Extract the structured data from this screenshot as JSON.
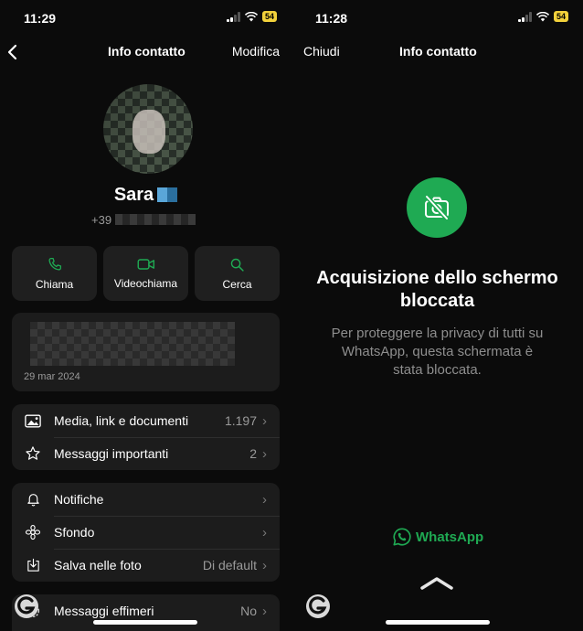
{
  "left": {
    "status": {
      "time": "11:29",
      "battery": "54"
    },
    "nav": {
      "title": "Info contatto",
      "edit": "Modifica"
    },
    "profile": {
      "name": "Sara",
      "phone_prefix": "+39"
    },
    "actions": [
      {
        "icon": "phone-icon",
        "label": "Chiama"
      },
      {
        "icon": "video-icon",
        "label": "Videochiama"
      },
      {
        "icon": "search-icon",
        "label": "Cerca"
      }
    ],
    "about": {
      "date": "29 mar 2024"
    },
    "group1": [
      {
        "icon": "photo-icon",
        "label": "Media, link e documenti",
        "value": "1.197"
      },
      {
        "icon": "star-icon",
        "label": "Messaggi importanti",
        "value": "2"
      }
    ],
    "group2": [
      {
        "icon": "bell-icon",
        "label": "Notifiche",
        "value": ""
      },
      {
        "icon": "wallpaper-icon",
        "label": "Sfondo",
        "value": ""
      },
      {
        "icon": "download-icon",
        "label": "Salva nelle foto",
        "value": "Di default"
      }
    ],
    "group3": [
      {
        "icon": "timer-icon",
        "label": "Messaggi effimeri",
        "value": "No"
      }
    ]
  },
  "right": {
    "status": {
      "time": "11:28",
      "battery": "54"
    },
    "nav": {
      "close": "Chiudi",
      "title": "Info contatto"
    },
    "lock": {
      "title": "Acquisizione dello schermo bloccata",
      "text": "Per proteggere la privacy di tutti su WhatsApp, questa schermata è stata bloccata."
    },
    "brand": "WhatsApp"
  },
  "colors": {
    "accent": "#1faa53",
    "battery": "#f2d13b",
    "card": "#1c1c1c"
  }
}
